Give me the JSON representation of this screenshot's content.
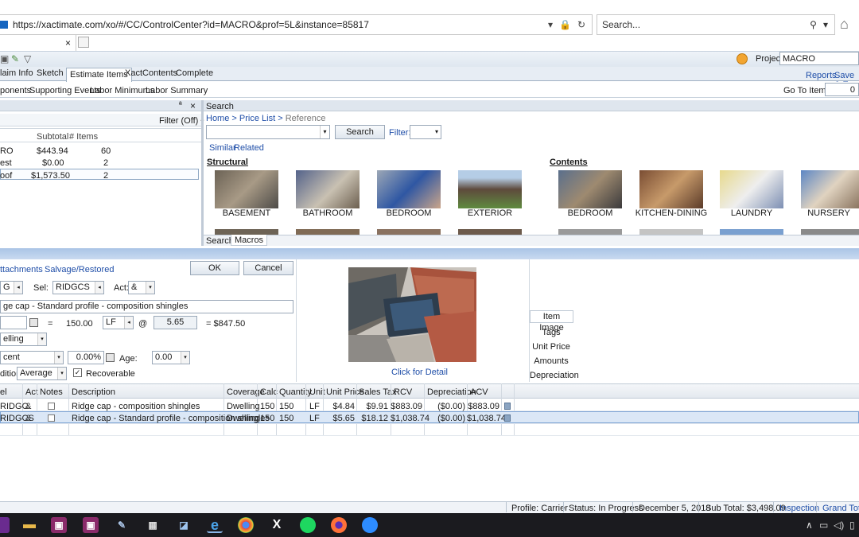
{
  "browser": {
    "url": "https://xactimate.com/xo/#/CC/ControlCenter?id=MACRO&prof=5L&instance=85817",
    "search_placeholder": "Search...",
    "tab_close": "×"
  },
  "header": {
    "project_label": "Project:",
    "project_value": "MACRO",
    "reports": "Reports",
    "save_exit": "Save & E"
  },
  "main_tabs": [
    "laim Info",
    "Sketch",
    "Estimate Items",
    "XactContents",
    "Complete"
  ],
  "sub_tabs": [
    "ponents",
    "Supporting Events",
    "Labor Minimums",
    "Labor Summary"
  ],
  "goto": {
    "label": "Go To Item #:",
    "value": "0"
  },
  "left_panel": {
    "pin": "ª",
    "close": "×",
    "filter": "Filter (Off)",
    "headers": [
      "Subtotal",
      "# Items"
    ],
    "rows": [
      {
        "name": "RO",
        "subtotal": "$443.94",
        "items": "60"
      },
      {
        "name": "est",
        "subtotal": "$0.00",
        "items": "2"
      },
      {
        "name": "oof",
        "subtotal": "$1,573.50",
        "items": "2"
      }
    ]
  },
  "search_panel": {
    "title": "Search",
    "breadcrumb_home": "Home",
    "breadcrumb_pricelist": "Price List",
    "breadcrumb_ref": "Reference",
    "sep": ">",
    "search_button": "Search",
    "filter_label": "Filter:",
    "similar": "Similar",
    "related": "Related",
    "structural": "Structural",
    "contents": "Contents",
    "thumbs": [
      "BASEMENT",
      "BATHROOM",
      "BEDROOM",
      "EXTERIOR",
      "BEDROOM",
      "KITCHEN-DINING",
      "LAUNDRY",
      "NURSERY"
    ],
    "bottom_tabs": [
      "Search",
      "Macros"
    ]
  },
  "editor": {
    "attachments": "ttachments",
    "salvage": "Salvage/Restored",
    "ok": "OK",
    "cancel": "Cancel",
    "cat_value": "G",
    "sel_label": "Sel:",
    "sel_value": "RIDGCS",
    "act_label": "Act:",
    "act_value": "&",
    "description": "ge cap - Standard profile - composition shingles",
    "eq": "=",
    "qty": "150.00",
    "unit": "LF",
    "at": "@",
    "price": "5.65",
    "total": "= $847.50",
    "coverage": "elling",
    "tax_type": "cent",
    "percent": "0.00%",
    "age_label": "Age:",
    "age_value": "0.00",
    "condition_label": "dition:",
    "condition_value": "Average",
    "recoverable": "Recoverable",
    "click_detail": "Click for Detail",
    "right_tabs": [
      "Item Image",
      "Tags",
      "Unit Price",
      "Amounts",
      "Depreciation"
    ]
  },
  "table": {
    "headers": [
      "el",
      "Act",
      "Notes",
      "Description",
      "Coverage",
      "Calc",
      "Quantity",
      "Unit",
      "Unit Price",
      "Sales Tax",
      "RCV",
      "Depreciation",
      "ACV"
    ],
    "rows": [
      {
        "sel": "RIDGC",
        "act": "&",
        "desc": "Ridge cap - composition shingles",
        "coverage": "Dwelling",
        "calc": "150",
        "qty": "150",
        "unit": "LF",
        "unit_price": "$4.84",
        "tax": "$9.91",
        "rcv": "$883.09",
        "dep": "($0.00)",
        "acv": "$883.09"
      },
      {
        "sel": "RIDGCS",
        "act": "&",
        "desc": "Ridge cap - Standard profile - composition shingles",
        "coverage": "Dwelling",
        "calc": "150",
        "qty": "150",
        "unit": "LF",
        "unit_price": "$5.65",
        "tax": "$18.12",
        "rcv": "$1,038.74",
        "dep": "($0.00)",
        "acv": "$1,038.74"
      }
    ]
  },
  "status": {
    "profile": "Profile:  Carrier",
    "status": "Status:  In Progress",
    "date": "December 5, 2018",
    "subtotal": "Sub Total: $3,498.09",
    "inspection": "Inspection",
    "grand_total": "Grand Total:"
  },
  "colors": {
    "accent": "#1f4ea8",
    "splitter": "#aac4e6",
    "taskbar": "#1b1b1f"
  }
}
